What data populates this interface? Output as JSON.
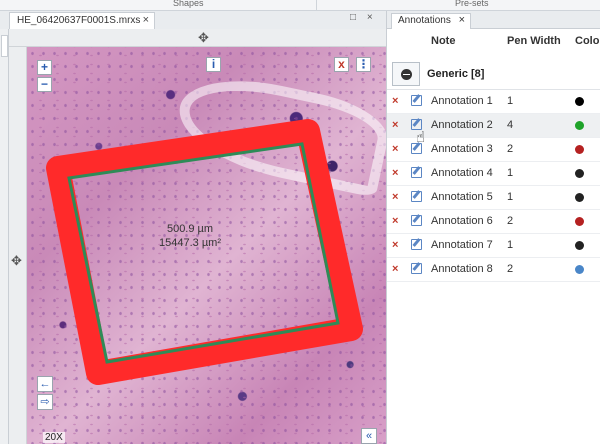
{
  "topbar": {
    "left_label": "Shapes",
    "right_label": "Pre-sets"
  },
  "viewer": {
    "tab_title": "HE_06420637F0001S.mrxs",
    "close": "×",
    "restore_icon": "□",
    "close_window": "×",
    "pan_icon": "✥",
    "magnification": "20X",
    "zoom_in": "+",
    "zoom_out": "−",
    "info": "i",
    "delete_x": "x",
    "menu_icon": "⋮",
    "nav_left": "←",
    "nav_right": "⇨",
    "nav_collapse": "«"
  },
  "measurement": {
    "length": "500.9 µm",
    "area": "15447.3 µm²"
  },
  "annotation_colors": {
    "outer": "#ff2a2a",
    "inner": "#2e8b57"
  },
  "panel": {
    "tab_title": "Annotations",
    "close": "×",
    "headers": {
      "note": "Note",
      "pen_width": "Pen Width",
      "color": "Colo"
    },
    "group": {
      "label": "Generic [8]"
    },
    "rows": [
      {
        "name": "Annotation 1",
        "pen_width": "1",
        "color": "#000000",
        "del": "×"
      },
      {
        "name": "Annotation 2",
        "pen_width": "4",
        "color": "#1fa32a",
        "del": "×"
      },
      {
        "name": "Annotation 3",
        "pen_width": "2",
        "color": "#b52121",
        "del": "×"
      },
      {
        "name": "Annotation 4",
        "pen_width": "1",
        "color": "#222222",
        "del": "×"
      },
      {
        "name": "Annotation 5",
        "pen_width": "1",
        "color": "#222222",
        "del": "×"
      },
      {
        "name": "Annotation 6",
        "pen_width": "2",
        "color": "#b52121",
        "del": "×"
      },
      {
        "name": "Annotation 7",
        "pen_width": "1",
        "color": "#222222",
        "del": "×"
      },
      {
        "name": "Annotation 8",
        "pen_width": "2",
        "color": "#4a86c8",
        "del": "×"
      }
    ]
  }
}
